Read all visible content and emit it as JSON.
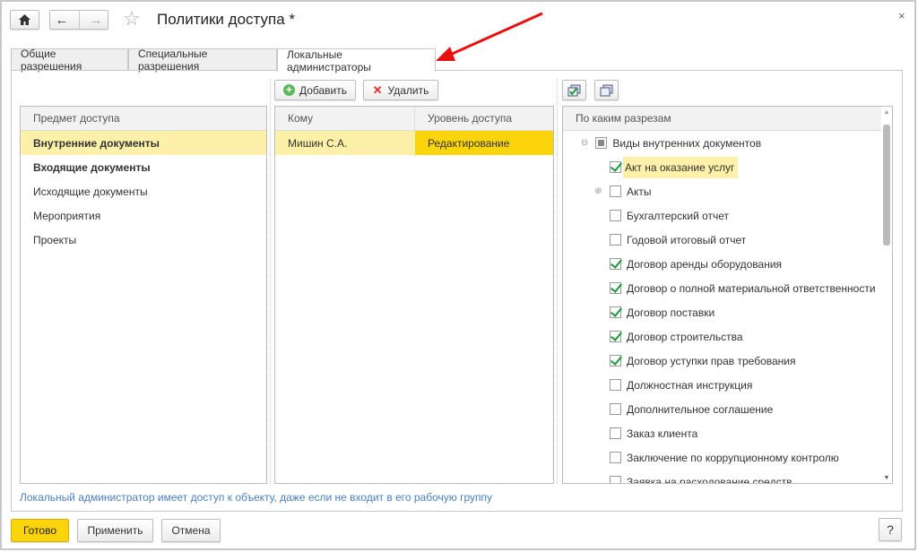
{
  "title": "Политики доступа *",
  "tabs": [
    {
      "label": "Общие разрешения"
    },
    {
      "label": "Специальные разрешения"
    },
    {
      "label": "Локальные администраторы",
      "active": true
    }
  ],
  "toolbar": {
    "add": "Добавить",
    "delete": "Удалить"
  },
  "subjects": {
    "header": "Предмет доступа",
    "items": [
      {
        "label": "Внутренние документы",
        "bold": true,
        "selected": true
      },
      {
        "label": "Входящие документы",
        "bold": true
      },
      {
        "label": "Исходящие документы"
      },
      {
        "label": "Мероприятия"
      },
      {
        "label": "Проекты"
      }
    ]
  },
  "admins": {
    "columns": [
      "Кому",
      "Уровень доступа"
    ],
    "rows": [
      {
        "who": "Мишин С.А.",
        "level": "Редактирование"
      }
    ]
  },
  "sections": {
    "header": "По каким разрезам",
    "root": "Виды внутренних документов",
    "items": [
      {
        "label": "Акт на оказание услуг",
        "checked": true,
        "selected": true
      },
      {
        "label": "Акты",
        "checked": false,
        "expandable": true
      },
      {
        "label": "Бухгалтерский отчет",
        "checked": false
      },
      {
        "label": "Годовой итоговый отчет",
        "checked": false
      },
      {
        "label": "Договор аренды оборудования",
        "checked": true
      },
      {
        "label": "Договор о полной материальной ответственности",
        "checked": true
      },
      {
        "label": "Договор поставки",
        "checked": true
      },
      {
        "label": "Договор строительства",
        "checked": true
      },
      {
        "label": "Договор уступки прав требования",
        "checked": true
      },
      {
        "label": "Должностная инструкция",
        "checked": false
      },
      {
        "label": "Дополнительное соглашение",
        "checked": false
      },
      {
        "label": "Заказ клиента",
        "checked": false
      },
      {
        "label": "Заключение по коррупционному контролю",
        "checked": false
      },
      {
        "label": "Заявка на расходование средств",
        "checked": false
      }
    ]
  },
  "note": "Локальный администратор имеет доступ к объекту, даже если не входит в его рабочую группу",
  "footer": {
    "done": "Готово",
    "apply": "Применить",
    "cancel": "Отмена",
    "help": "?"
  },
  "colors": {
    "accent": "#fbd40b",
    "selection": "#fdf0a8",
    "link": "#4a7fbf",
    "arrow": "#e81010"
  }
}
